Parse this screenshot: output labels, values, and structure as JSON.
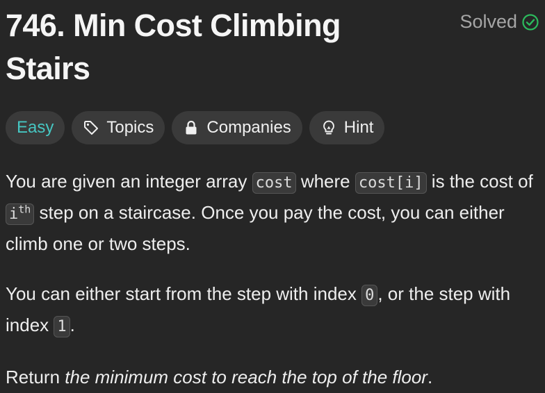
{
  "problem": {
    "title": "746. Min Cost Climbing Stairs",
    "status": "Solved"
  },
  "tags": {
    "difficulty": "Easy",
    "topics": "Topics",
    "companies": "Companies",
    "hint": "Hint"
  },
  "colors": {
    "difficulty_easy": "#46c6c2",
    "solved_check": "#2cbb5d"
  },
  "icons": {
    "solved": "check-circle-icon",
    "topics": "tag-icon",
    "companies": "lock-icon",
    "hint": "lightbulb-icon"
  },
  "description": {
    "p1": {
      "t1": "You are given an integer array ",
      "c1": "cost",
      "t2": " where ",
      "c2": "cost[i]",
      "t3": " is the cost of ",
      "c3_base": "i",
      "c3_sup": "th",
      "t4": " step on a staircase. Once you pay the cost, you can either climb one or two steps."
    },
    "p2": {
      "t1": "You can either start from the step with index ",
      "c1": "0",
      "t2": ", or the step with index ",
      "c2": "1",
      "t3": "."
    },
    "p3": {
      "t1": "Return ",
      "em": "the minimum cost to reach the top of the floor",
      "t2": "."
    }
  }
}
